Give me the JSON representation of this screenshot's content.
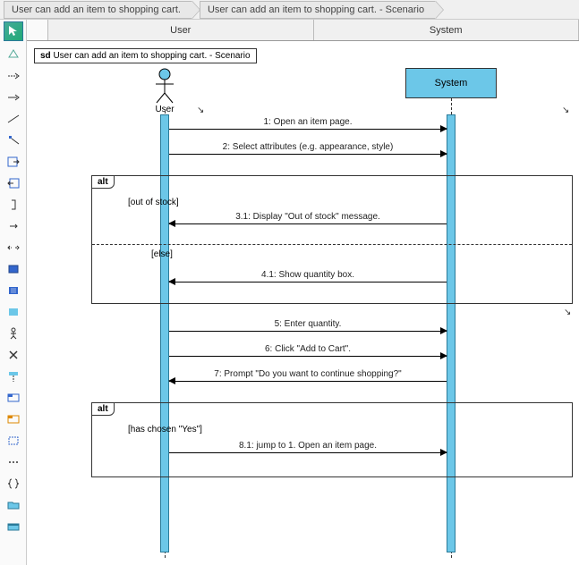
{
  "breadcrumb": {
    "item1": "User can add an item to shopping cart.",
    "item2": "User can add an item to shopping cart. - Scenario"
  },
  "header": {
    "col1": "User",
    "col2": "System"
  },
  "sd": {
    "prefix": "sd",
    "title": "User can add an item to shopping cart. - Scenario"
  },
  "actor": {
    "label": "User"
  },
  "system": {
    "label": "System"
  },
  "messages": {
    "m1": "1: Open an item page.",
    "m2": "2: Select attributes (e.g. appearance, style)",
    "m3_1": "3.1: Display \"Out of stock\" message.",
    "m4_1": "4.1: Show quantity box.",
    "m5": "5: Enter quantity.",
    "m6": "6: Click \"Add to Cart\".",
    "m7": "7: Prompt \"Do you want to continue shopping?\"",
    "m8_1": "8.1: jump to 1. Open an item page."
  },
  "alt1": {
    "label": "alt",
    "guard1": "[out of stock]",
    "guard2": "[else]"
  },
  "alt2": {
    "label": "alt",
    "guard1": "[has chosen \"Yes\"]"
  }
}
